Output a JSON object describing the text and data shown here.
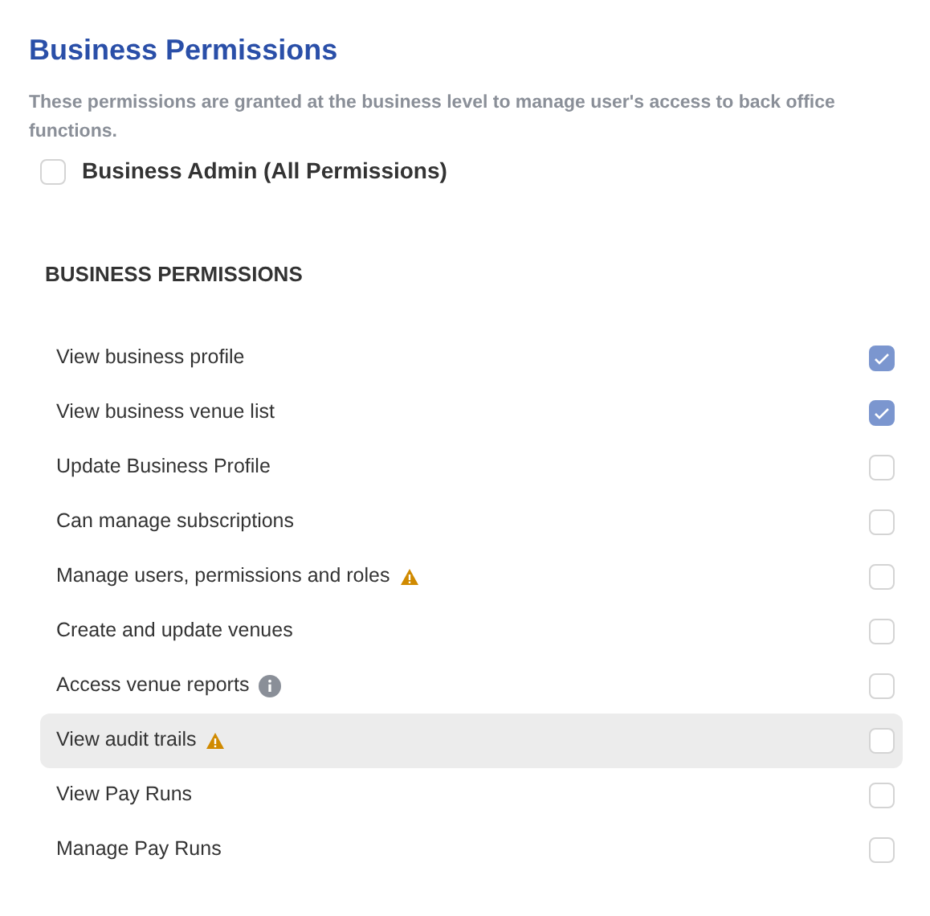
{
  "title": "Business Permissions",
  "description": "These permissions are granted at the business level to manage user's access to back office functions.",
  "admin": {
    "label": "Business Admin (All Permissions)",
    "checked": false
  },
  "section": {
    "heading": "BUSINESS PERMISSIONS",
    "permissions": [
      {
        "label": "View business profile",
        "checked": true,
        "highlighted": false
      },
      {
        "label": "View business venue list",
        "checked": true,
        "highlighted": false
      },
      {
        "label": "Update Business Profile",
        "checked": false,
        "highlighted": false
      },
      {
        "label": "Can manage subscriptions",
        "checked": false,
        "highlighted": false
      },
      {
        "label": "Manage users, permissions and roles",
        "kind": "warning",
        "checked": false,
        "highlighted": false
      },
      {
        "label": "Create and update venues",
        "checked": false,
        "highlighted": false
      },
      {
        "label": "Access venue reports",
        "kind": "info",
        "checked": false,
        "highlighted": false
      },
      {
        "label": "View audit trails",
        "kind": "warning",
        "checked": false,
        "highlighted": true
      },
      {
        "label": "View Pay Runs",
        "checked": false,
        "highlighted": false
      },
      {
        "label": "Manage Pay Runs",
        "checked": false,
        "highlighted": false
      }
    ]
  }
}
